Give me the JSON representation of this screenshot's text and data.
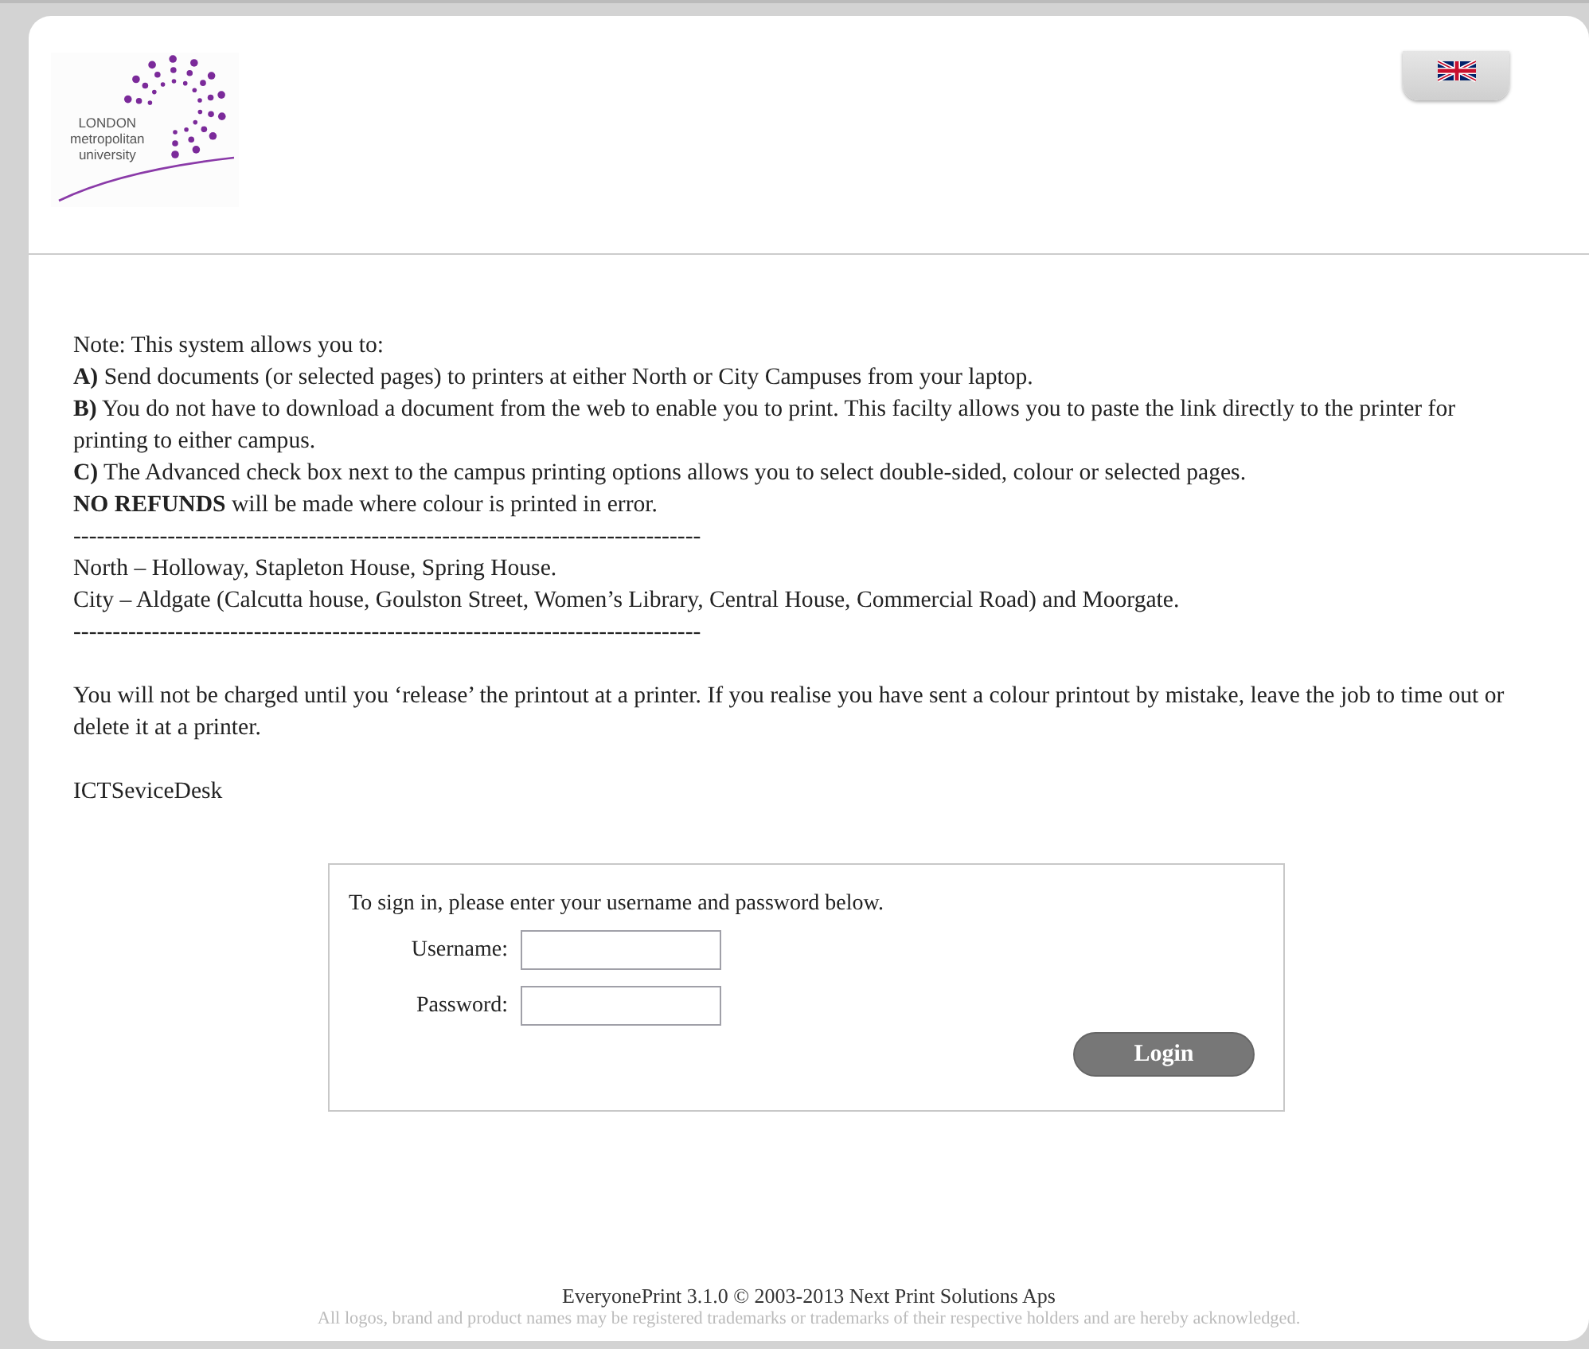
{
  "logo": {
    "lines": [
      "LONDON",
      "metropolitan",
      "university"
    ]
  },
  "notice": {
    "lines": [
      "Note: This system allows you to:",
      "**A)** Send documents (or selected pages) to printers at either North or City Campuses from your laptop.",
      "**B)** You do not have to download a document from the web to enable you to print. This facilty allows you to paste the link directly to the printer for printing to either campus.",
      "**C)** The Advanced check box next to the campus printing options allows you to select double-sided, colour or selected pages.",
      "**NO REFUNDS** will be made where colour is printed in error.",
      "--------------------------------------------------------------------------------",
      "North – Holloway, Stapleton House, Spring House.",
      "City – Aldgate (Calcutta house, Goulston Street, Women’s Library, Central House, Commercial Road) and Moorgate.",
      "--------------------------------------------------------------------------------"
    ],
    "charge_note": "You will not be charged until you ‘release’ the printout at a printer. If you realise you have sent a colour printout by mistake, leave the job to time out or delete it at a printer.",
    "signature": "ICTSeviceDesk"
  },
  "login": {
    "intro": "To sign in, please enter your username and password below.",
    "fields": [
      {
        "label": "Username:"
      },
      {
        "label": "Password:"
      }
    ],
    "button": "Login"
  },
  "footer": {
    "product": "EveryonePrint 3.1.0 © 2003-2013 Next Print Solutions Aps",
    "disclaimer": "All logos, brand and product names may be registered trademarks or trademarks of their respective holders and are hereby acknowledged."
  }
}
